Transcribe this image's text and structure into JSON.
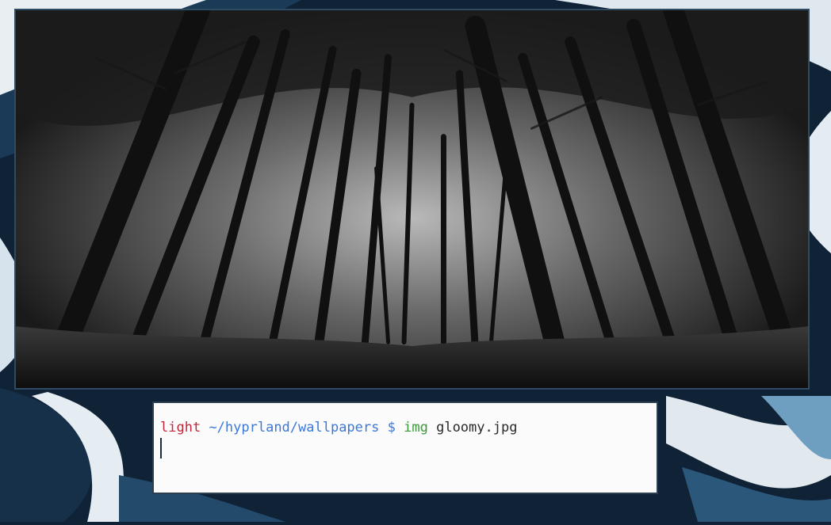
{
  "desktop": {
    "wallpaper_icon": "abstract-ribbon-wallpaper",
    "wallpaper_colors": [
      "#0f2236",
      "#234a6b",
      "#e8eef2",
      "#6f9fc0"
    ]
  },
  "viewer": {
    "image_subject": "dark misty forest viewed from below",
    "border_color": "#2e4b63"
  },
  "terminal": {
    "prompt": {
      "host": "light",
      "path": "~/hyprland/wallpapers",
      "symbol": "$"
    },
    "command": {
      "name": "img",
      "argument": "gloomy.jpg"
    },
    "colors": {
      "host": "#c2253a",
      "path": "#3c78d8",
      "command": "#3a9a3a",
      "background": "#fbfbfb"
    }
  }
}
